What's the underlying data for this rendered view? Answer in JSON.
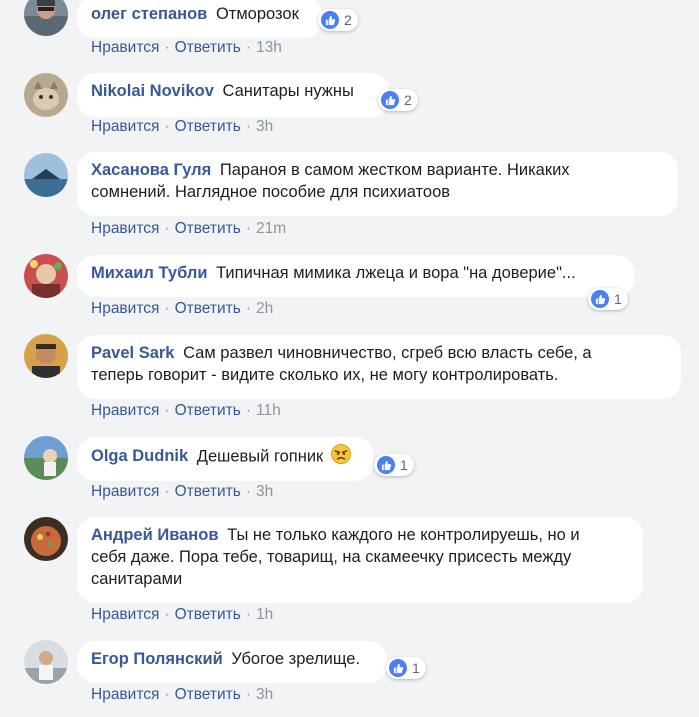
{
  "ui": {
    "like_label": "Нравится",
    "reply_label": "Ответить",
    "separator": "·"
  },
  "colors": {
    "author": "#385898",
    "like_badge": "#4a80f5",
    "bubble": "#ffffff",
    "background": "#f2f3f5"
  },
  "comments": [
    {
      "author": "олег степанов",
      "text": "Отморозок",
      "time": "13h",
      "reactions": "2"
    },
    {
      "author": "Nikolai Novikov",
      "text": "Санитары нужны",
      "time": "3h",
      "reactions": "2"
    },
    {
      "author": "Хасанова Гуля",
      "text_line1": "Параноя в самом жестком варианте. Никаких",
      "text_line2": "сомнений. Наглядное пособие для психиатоов",
      "time": "21m"
    },
    {
      "author": "Михаил Тубли",
      "text": "Типичная мимика лжеца и вора \"на доверие\"...",
      "time": "2h",
      "reactions": "1"
    },
    {
      "author": "Pavel Sark",
      "text_line1": "Сам развел чиновничество, сгреб всю власть себе, а",
      "text_line2": "теперь говорит - видите сколько их, не могу контролировать.",
      "time": "11h"
    },
    {
      "author": "Olga Dudnik",
      "text": "Дешевый гопник",
      "emoji": "angry-face",
      "time": "3h",
      "reactions": "1"
    },
    {
      "author": "Андрей Иванов",
      "text_line1": "Ты не только каждого не контролируешь, но и",
      "text_line2": "себя даже. Пора тебе, товарищ, на скамеечку присесть между",
      "text_line3": "санитарами",
      "time": "1h"
    },
    {
      "author": "Егор Полянский",
      "text": "Убогое зрелище.",
      "time": "3h",
      "reactions": "1"
    }
  ]
}
